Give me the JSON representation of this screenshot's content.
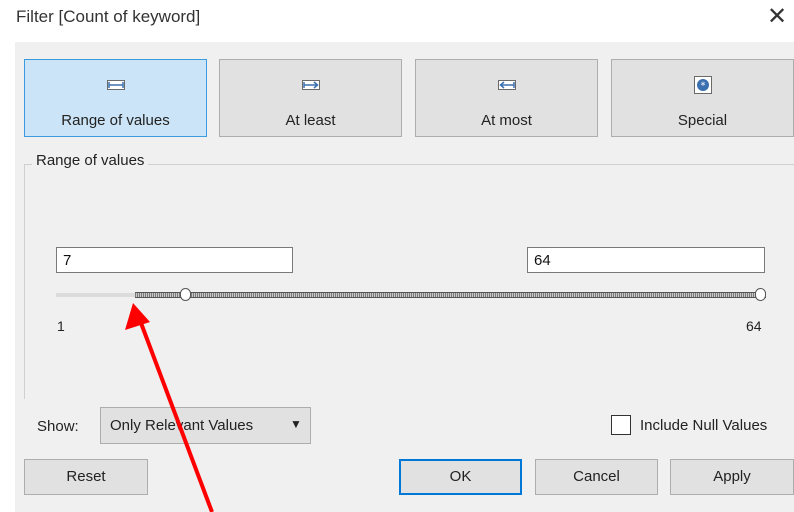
{
  "window": {
    "title": "Filter [Count of keyword]",
    "close_glyph": "✕"
  },
  "tabs": [
    {
      "label": "Range of values",
      "icon": "range-icon",
      "selected": true
    },
    {
      "label": "At least",
      "icon": "at-least-icon",
      "selected": false
    },
    {
      "label": "At most",
      "icon": "at-most-icon",
      "selected": false
    },
    {
      "label": "Special",
      "icon": "special-icon",
      "selected": false
    }
  ],
  "range_group": {
    "label": "Range of values",
    "min_value": "7",
    "max_value": "64",
    "slider": {
      "min": 1,
      "max": 64,
      "low": 7,
      "high": 64,
      "min_label": "1",
      "max_label": "64"
    }
  },
  "show": {
    "label": "Show:",
    "value": "Only Relevant Values",
    "caret": "▼"
  },
  "include_null": {
    "label": "Include Null Values",
    "checked": false
  },
  "buttons": {
    "reset": "Reset",
    "ok": "OK",
    "cancel": "Cancel",
    "apply": "Apply"
  },
  "colors": {
    "selected_tab_bg": "#cce4f7",
    "selected_tab_border": "#3c9be0",
    "annotation_arrow": "#ff0000",
    "default_button_border": "#0078d7"
  }
}
